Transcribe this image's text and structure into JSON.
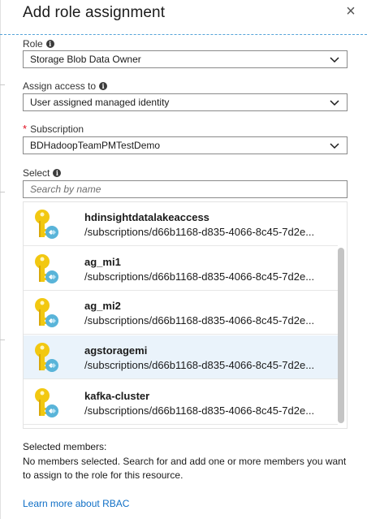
{
  "panel": {
    "title": "Add role assignment",
    "close_label": "×"
  },
  "role": {
    "label": "Role",
    "value": "Storage Blob Data Owner"
  },
  "assign_access": {
    "label": "Assign access to",
    "value": "User assigned managed identity"
  },
  "subscription": {
    "label": "Subscription",
    "required_mark": "*",
    "value": "BDHadoopTeamPMTestDemo"
  },
  "select": {
    "label": "Select",
    "placeholder": "Search by name"
  },
  "identities": [
    {
      "name": "hdinsightdatalakeaccess",
      "path": "/subscriptions/d66b1168-d835-4066-8c45-7d2e...",
      "selected": false
    },
    {
      "name": "ag_mi1",
      "path": "/subscriptions/d66b1168-d835-4066-8c45-7d2e...",
      "selected": false
    },
    {
      "name": "ag_mi2",
      "path": "/subscriptions/d66b1168-d835-4066-8c45-7d2e...",
      "selected": false
    },
    {
      "name": "agstoragemi",
      "path": "/subscriptions/d66b1168-d835-4066-8c45-7d2e...",
      "selected": true
    },
    {
      "name": "kafka-cluster",
      "path": "/subscriptions/d66b1168-d835-4066-8c45-7d2e...",
      "selected": false
    }
  ],
  "selected_members": {
    "title": "Selected members:",
    "description": "No members selected. Search for and add one or more members you want to assign to the role for this resource."
  },
  "learn_more": "Learn more about RBAC",
  "colors": {
    "accent_link": "#0f6fc6",
    "required": "#e00b1c",
    "key_gold": "#f2c811",
    "badge_blue": "#59b4d9",
    "selected_row": "#eaf3fb"
  },
  "icons": {
    "close": "close-icon",
    "info": "info-icon",
    "dropdown": "chevron-down-icon",
    "identity": "managed-identity-key-icon"
  }
}
